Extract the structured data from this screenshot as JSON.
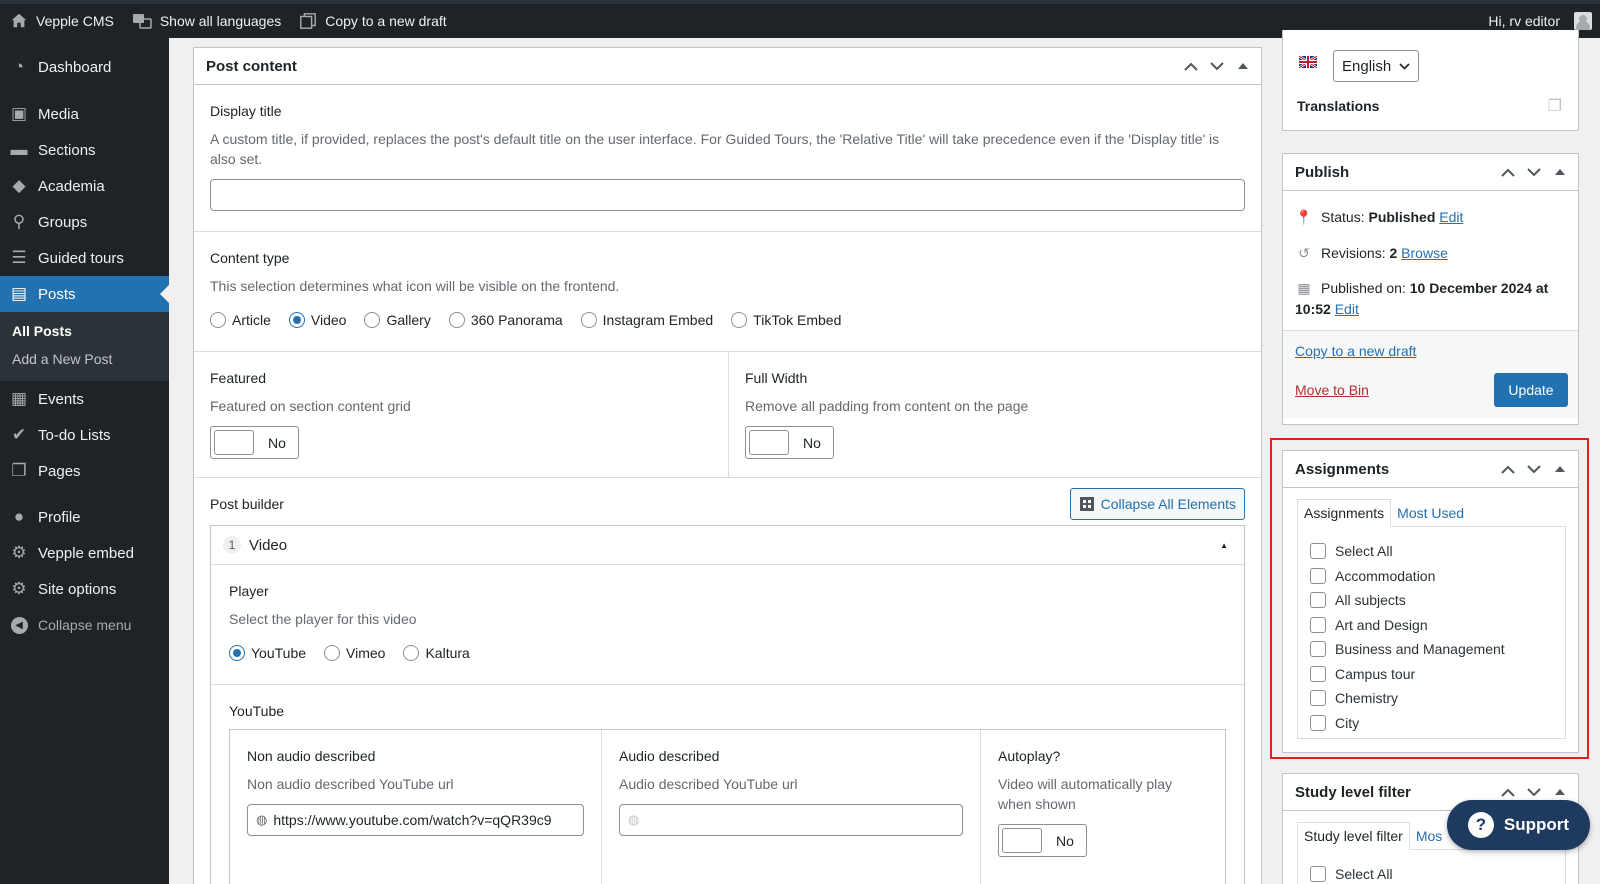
{
  "admin_bar": {
    "site_name": "Vepple CMS",
    "languages": "Show all languages",
    "copy_draft": "Copy to a new draft",
    "greeting": "Hi, rv editor"
  },
  "sidebar": {
    "items": [
      {
        "label": "Dashboard",
        "icon": "dashboard-icon"
      },
      {
        "label": "Media",
        "icon": "media-icon"
      },
      {
        "label": "Sections",
        "icon": "folder-icon"
      },
      {
        "label": "Academia",
        "icon": "graduation-cap-icon"
      },
      {
        "label": "Groups",
        "icon": "location-pin-icon"
      },
      {
        "label": "Guided tours",
        "icon": "list-icon"
      },
      {
        "label": "Posts",
        "icon": "posts-icon"
      },
      {
        "label": "Events",
        "icon": "calendar-icon"
      },
      {
        "label": "To-do Lists",
        "icon": "check-circle-icon"
      },
      {
        "label": "Pages",
        "icon": "pages-icon"
      },
      {
        "label": "Profile",
        "icon": "user-icon"
      },
      {
        "label": "Vepple embed",
        "icon": "gear-icon"
      },
      {
        "label": "Site options",
        "icon": "gear-icon"
      }
    ],
    "submenu": [
      "All Posts",
      "Add a New Post"
    ],
    "collapse": "Collapse menu"
  },
  "post_content": {
    "title": "Post content",
    "display_title": {
      "label": "Display title",
      "desc": "A custom title, if provided, replaces the post's default title on the user interface. For Guided Tours, the 'Relative Title' will take precedence even if the 'Display title' is also set.",
      "value": ""
    },
    "content_type": {
      "label": "Content type",
      "desc": "This selection determines what icon will be visible on the frontend.",
      "options": [
        "Article",
        "Video",
        "Gallery",
        "360 Panorama",
        "Instagram Embed",
        "TikTok Embed"
      ],
      "selected": "Video"
    },
    "featured": {
      "label": "Featured",
      "desc": "Featured on section content grid",
      "value": "No"
    },
    "full_width": {
      "label": "Full Width",
      "desc": "Remove all padding from content on the page",
      "value": "No"
    },
    "post_builder": {
      "label": "Post builder",
      "collapse_btn": "Collapse All Elements",
      "element_index": "1",
      "element_name": "Video",
      "player": {
        "label": "Player",
        "desc": "Select the player for this video",
        "options": [
          "YouTube",
          "Vimeo",
          "Kaltura"
        ],
        "selected": "YouTube"
      },
      "youtube": {
        "label": "YouTube",
        "non_audio": {
          "label": "Non audio described",
          "desc": "Non audio described YouTube url",
          "value": "https://www.youtube.com/watch?v=qQR39c9"
        },
        "audio": {
          "label": "Audio described",
          "desc": "Audio described YouTube url",
          "value": ""
        },
        "autoplay": {
          "label": "Autoplay?",
          "desc": "Video will automatically play when shown",
          "value": "No"
        }
      }
    }
  },
  "language_box": {
    "language": "English",
    "translations": "Translations"
  },
  "publish": {
    "title": "Publish",
    "status_label": "Status:",
    "status_value": "Published",
    "status_edit": "Edit",
    "revisions_label": "Revisions:",
    "revisions_value": "2",
    "revisions_browse": "Browse",
    "published_label": "Published on:",
    "published_value": "10 December 2024 at",
    "published_time": "10:52",
    "published_edit": "Edit",
    "copy_draft": "Copy to a new draft",
    "move_bin": "Move to Bin",
    "update": "Update"
  },
  "assignments": {
    "title": "Assignments",
    "tabs": [
      "Assignments",
      "Most Used"
    ],
    "items": [
      "Select All",
      "Accommodation",
      "All subjects",
      "Art and Design",
      "Business and Management",
      "Campus tour",
      "Chemistry",
      "City"
    ]
  },
  "study_level": {
    "title": "Study level filter",
    "tabs": [
      "Study level filter",
      "Mos"
    ],
    "items": [
      "Select All"
    ]
  },
  "support": {
    "label": "Support"
  },
  "colors": {
    "accent": "#2271b1",
    "admin_dark": "#1d2327",
    "highlight": "#e0201c",
    "danger": "#b32d2e"
  }
}
